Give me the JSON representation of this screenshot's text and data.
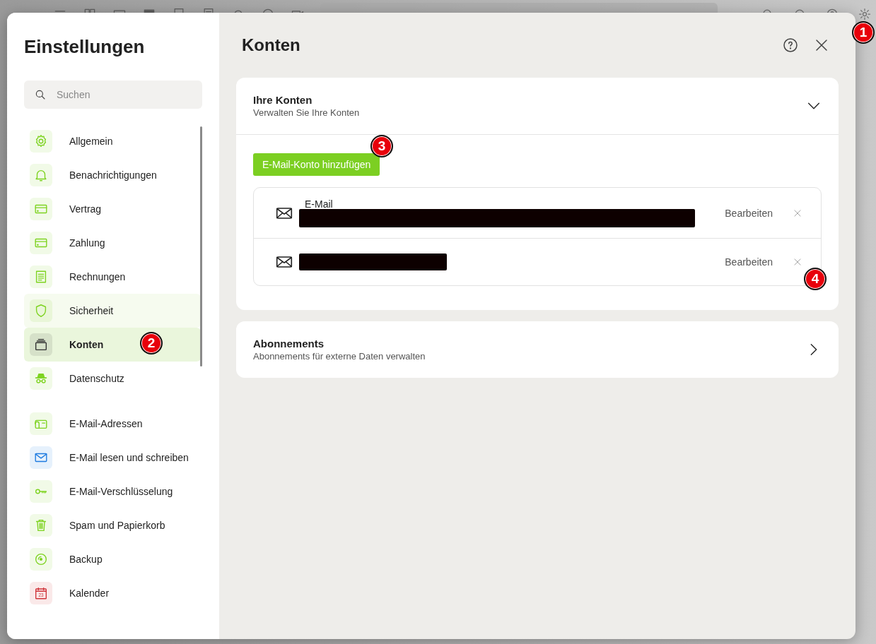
{
  "sidebar": {
    "title": "Einstellungen",
    "search": {
      "placeholder": "Suchen"
    },
    "groups": [
      {
        "items": [
          {
            "label": "Allgemein",
            "kind": "gear",
            "color": "#7ed321",
            "selected": false,
            "hovered": false
          },
          {
            "label": "Benachrichtigungen",
            "kind": "bell",
            "color": "#7ed321",
            "selected": false,
            "hovered": false
          },
          {
            "label": "Vertrag",
            "kind": "card",
            "color": "#7ed321",
            "selected": false,
            "hovered": false
          },
          {
            "label": "Zahlung",
            "kind": "card",
            "color": "#7ed321",
            "selected": false,
            "hovered": false
          },
          {
            "label": "Rechnungen",
            "kind": "invoice",
            "color": "#7ed321",
            "selected": false,
            "hovered": false
          },
          {
            "label": "Sicherheit",
            "kind": "shield",
            "color": "#7ed321",
            "selected": false,
            "hovered": true
          },
          {
            "label": "Konten",
            "kind": "stack",
            "color": "#333333",
            "selected": true,
            "hovered": false
          },
          {
            "label": "Datenschutz",
            "kind": "incognito",
            "color": "#7ed321",
            "selected": false,
            "hovered": false
          }
        ]
      },
      {
        "items": [
          {
            "label": "E-Mail-Adressen",
            "kind": "mailbox",
            "color": "#7ed321",
            "selected": false,
            "hovered": false
          },
          {
            "label": "E-Mail lesen und schreiben",
            "kind": "envelope",
            "color": "#1e7be0",
            "selected": false,
            "hovered": false
          },
          {
            "label": "E-Mail-Verschlüsselung",
            "kind": "key",
            "color": "#7ed321",
            "selected": false,
            "hovered": false
          },
          {
            "label": "Spam und Papierkorb",
            "kind": "trash",
            "color": "#7ed321",
            "selected": false,
            "hovered": false
          },
          {
            "label": "Backup",
            "kind": "disc",
            "color": "#7ed321",
            "selected": false,
            "hovered": false
          },
          {
            "label": "Kalender",
            "kind": "calendar",
            "color": "#d0343a",
            "selected": false,
            "hovered": false,
            "icon_text": "23"
          }
        ]
      }
    ]
  },
  "main": {
    "title": "Konten",
    "sections": [
      {
        "title": "Ihre Konten",
        "subtitle": "Verwalten Sie Ihre Konten",
        "expanded": true,
        "add_button": "E-Mail-Konto hinzufügen",
        "accounts": [
          {
            "label": "E-Mail",
            "edit": "Bearbeiten"
          },
          {
            "edit": "Bearbeiten"
          }
        ]
      },
      {
        "title": "Abonnements",
        "subtitle": "Abonnements für externe Daten verwalten",
        "expanded": false
      }
    ]
  },
  "markers": [
    {
      "number": "1"
    },
    {
      "number": "2"
    },
    {
      "number": "3"
    },
    {
      "number": "4"
    }
  ]
}
